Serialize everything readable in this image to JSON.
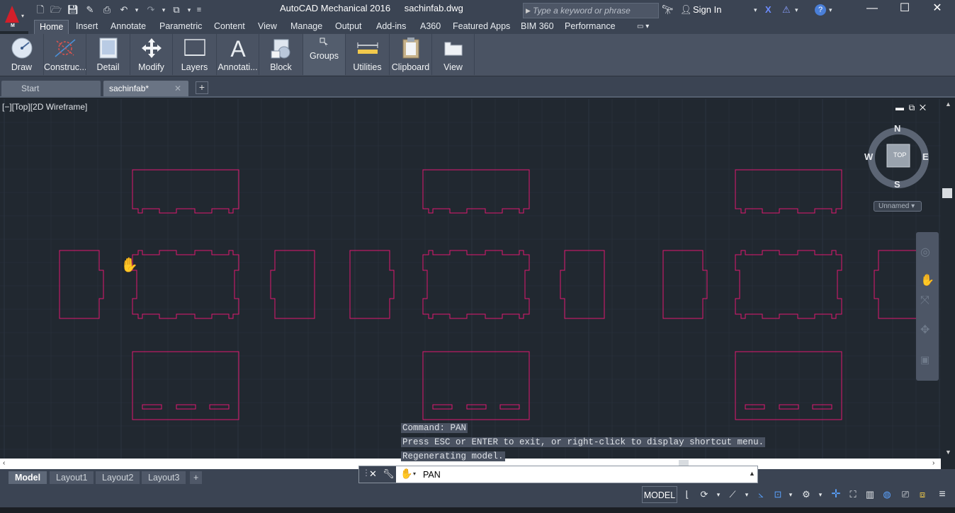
{
  "window": {
    "app_name": "AutoCAD Mechanical 2016",
    "file_name": "sachinfab.dwg"
  },
  "app_logo": {
    "letter": "M"
  },
  "search": {
    "placeholder": "Type a keyword or phrase"
  },
  "account": {
    "sign_in_label": "Sign In"
  },
  "ribbon_tabs": [
    {
      "label": "Home",
      "active": true
    },
    {
      "label": "Insert"
    },
    {
      "label": "Annotate"
    },
    {
      "label": "Parametric"
    },
    {
      "label": "Content"
    },
    {
      "label": "View"
    },
    {
      "label": "Manage"
    },
    {
      "label": "Output"
    },
    {
      "label": "Add-ins"
    },
    {
      "label": "A360"
    },
    {
      "label": "Featured Apps"
    },
    {
      "label": "BIM 360"
    },
    {
      "label": "Performance"
    }
  ],
  "ribbon_panels": [
    {
      "label": "Draw",
      "icon": "draw-icon"
    },
    {
      "label": "Construc...",
      "icon": "construction-icon"
    },
    {
      "label": "Detail",
      "icon": "detail-icon"
    },
    {
      "label": "Modify",
      "icon": "move-icon"
    },
    {
      "label": "Layers",
      "icon": "layers-icon"
    },
    {
      "label": "Annotati...",
      "icon": "text-icon"
    },
    {
      "label": "Block",
      "icon": "block-icon"
    },
    {
      "label": "Groups",
      "icon": "groups-icon"
    },
    {
      "label": "Utilities",
      "icon": "measure-icon"
    },
    {
      "label": "Clipboard",
      "icon": "clipboard-icon"
    },
    {
      "label": "View",
      "icon": "view-icon"
    }
  ],
  "file_tabs": [
    {
      "label": "Start"
    },
    {
      "label": "sachinfab*",
      "active": true
    }
  ],
  "viewport": {
    "label": "[−][Top][2D Wireframe]",
    "viewcube": {
      "north": "N",
      "south": "S",
      "east": "E",
      "west": "W",
      "face": "TOP",
      "ucs": "Unnamed"
    }
  },
  "command_history": [
    "Command: PAN",
    "Press ESC or ENTER to exit, or right-click to display shortcut menu.",
    "Regenerating model."
  ],
  "command_line": {
    "value": "PAN"
  },
  "layout_tabs": [
    {
      "label": "Model",
      "active": true
    },
    {
      "label": "Layout1"
    },
    {
      "label": "Layout2"
    },
    {
      "label": "Layout3"
    }
  ],
  "status": {
    "space": "MODEL"
  },
  "colors": {
    "geometry": "#e0186f",
    "background": "#212830",
    "grid": "#2b333e",
    "chrome": "#3b4453"
  }
}
